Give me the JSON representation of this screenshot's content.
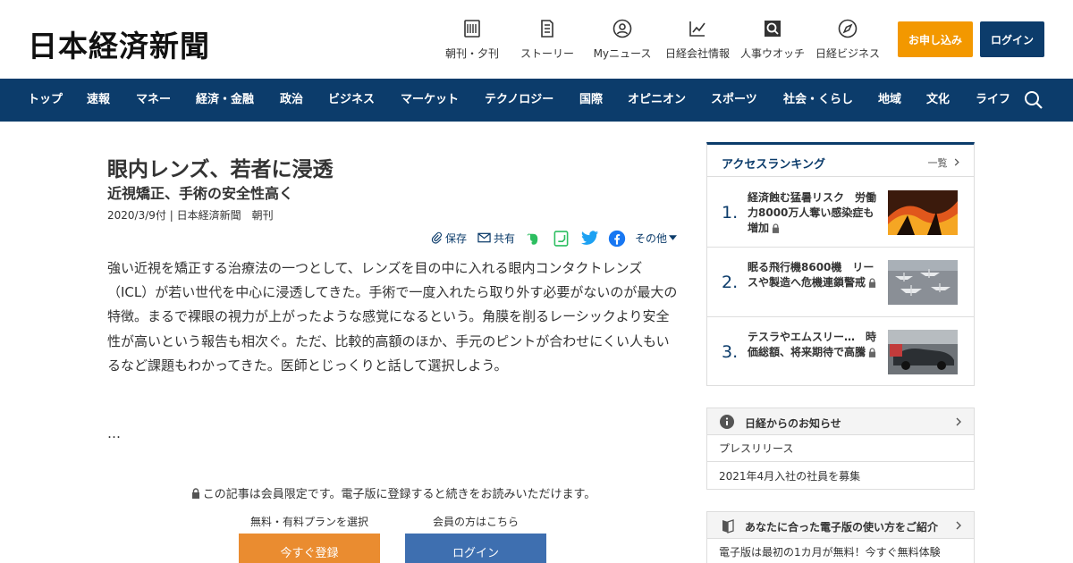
{
  "header": {
    "logo": "日本経済新聞",
    "nav": [
      {
        "label": "朝刊・夕刊",
        "icon": "newspaper-icon"
      },
      {
        "label": "ストーリー",
        "icon": "story-icon"
      },
      {
        "label": "Myニュース",
        "icon": "user-icon"
      },
      {
        "label": "日経会社情報",
        "icon": "chart-icon"
      },
      {
        "label": "人事ウオッチ",
        "icon": "magnifier-icon"
      },
      {
        "label": "日経ビジネス",
        "icon": "compass-icon"
      }
    ],
    "apply_label": "お申し込み",
    "login_label": "ログイン",
    "colors": {
      "brand": "#0c3c6b",
      "accent": "#f39800"
    }
  },
  "navbar": {
    "items": [
      "トップ",
      "速報",
      "マネー",
      "経済・金融",
      "政治",
      "ビジネス",
      "マーケット",
      "テクノロジー",
      "国際",
      "オピニオン",
      "スポーツ",
      "社会・くらし",
      "地域",
      "文化",
      "ライフ"
    ],
    "search_icon": "search-icon"
  },
  "article": {
    "title": "眼内レンズ、若者に浸透",
    "subtitle": "近視矯正、手術の安全性高く",
    "meta": "2020/3/9付 | 日本経済新聞　朝刊",
    "share": {
      "save": "保存",
      "share": "共有",
      "more": "その他"
    },
    "body": "強い近視を矯正する治療法の一つとして、レンズを目の中に入れる眼内コンタクトレンズ（ICL）が若い世代を中心に浸透してきた。手術で一度入れたら取り外す必要がないのが最大の特徴。まるで裸眼の視力が上がったような感覚になるという。角膜を削るレーシックより安全性が高いという報告も相次ぐ。ただ、比較的高額のほか、手元のピントが合わせにくい人もいるなど課題もわかってきた。医師とじっくりと話して選択しよう。",
    "ellipsis": "…",
    "paywall": "この記事は会員限定です。電子版に登録すると続きをお読みいただけます。",
    "plan_label": "無料・有料プランを選択",
    "member_label": "会員の方はこちら",
    "register_button": "今すぐ登録",
    "login_button": "ログイン"
  },
  "ranking": {
    "title": "アクセスランキング",
    "more": "一覧",
    "items": [
      {
        "num": "1.",
        "text": "経済蝕む猛暑リスク　労働力8000万人奪い感染症も増加"
      },
      {
        "num": "2.",
        "text": "眠る飛行機8600機　リースや製造へ危機連鎖警戒"
      },
      {
        "num": "3.",
        "text": "テスラやエムスリー…　時価総額、将来期待で高騰"
      }
    ]
  },
  "notice": {
    "title": "日経からのお知らせ",
    "items": [
      "プレスリリース",
      "2021年4月入社の社員を募集"
    ]
  },
  "guide": {
    "title": "あなたに合った電子版の使い方をご紹介",
    "text": "電子版は最初の1カ月が無料！今すぐ無料体験"
  }
}
